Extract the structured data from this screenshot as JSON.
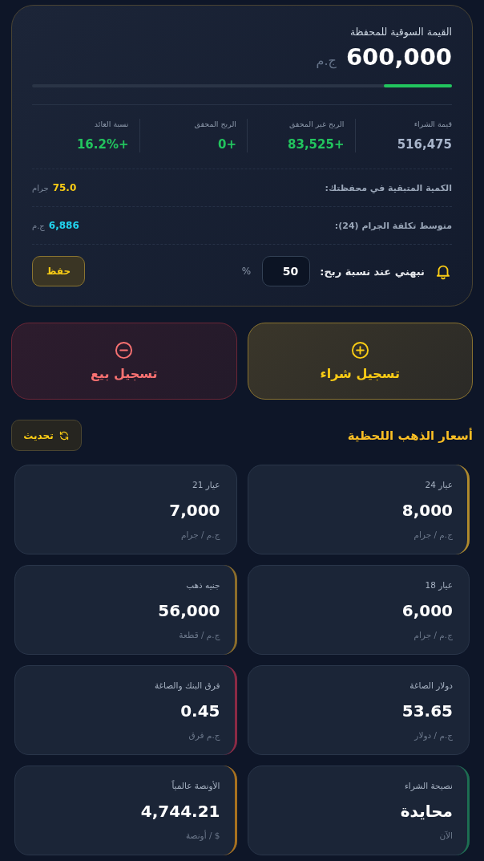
{
  "portfolio": {
    "title": "القيمة السوقية للمحفظة",
    "value": "600,000",
    "currency": "ج.م",
    "progress": {
      "level": 0.162
    },
    "stats": [
      {
        "label": "قيمة الشراء",
        "value": "516,475",
        "positive": false
      },
      {
        "label": "الربح غير المحقق",
        "value": "+83,525",
        "positive": true
      },
      {
        "label": "الربح المحقق",
        "value": "+0",
        "positive": true
      },
      {
        "label": "نسبة العائد",
        "value": "+16.2%",
        "positive": true
      }
    ],
    "details": [
      {
        "label": "الكمية المتبقية في محفظتك:",
        "value": "75.0",
        "unit": "جرام",
        "color": "#facc15"
      },
      {
        "label": "متوسط تكلفة الجرام (24):",
        "value": "6,886",
        "unit": "ج.م",
        "color": "#22d3ee"
      }
    ],
    "alert": {
      "label": "نبهني عند نسبة ربح:",
      "value": "50",
      "suffix": "%",
      "button": "حفظ"
    }
  },
  "actions": [
    {
      "kind": "buy",
      "label": "تسجيل شراء"
    },
    {
      "kind": "sell",
      "label": "تسجيل بيع"
    }
  ],
  "prices": {
    "title": "أسعار الذهب اللحظية",
    "refresh": "تحديث",
    "cards": [
      {
        "label": "عيار 24",
        "value": "8,000",
        "unit": "ج.م / جرام",
        "color": "#b08a2c"
      },
      {
        "label": "عيار 21",
        "value": "7,000",
        "unit": "ج.م / جرام"
      },
      {
        "label": "عيار 18",
        "value": "6,000",
        "unit": "ج.م / جرام"
      },
      {
        "label": "جنيه ذهب",
        "value": "56,000",
        "unit": "ج.م / قطعة",
        "color": "#8c6d2a"
      },
      {
        "label": "دولار الصاغة",
        "value": "53.65",
        "unit": "ج.م / دولار"
      },
      {
        "label": "فرق البنك والصاغة",
        "value": "0.45",
        "unit": "ج.م فرق",
        "color": "#8b2a45"
      },
      {
        "label": "نصيحة الشراء",
        "value": "محايدة",
        "unit": "الآن",
        "color": "#1d6e52"
      },
      {
        "label": "الأونصة عالمياً",
        "value": "4,744.21",
        "unit": "$ / أونصة",
        "color": "#a8711f"
      }
    ]
  }
}
